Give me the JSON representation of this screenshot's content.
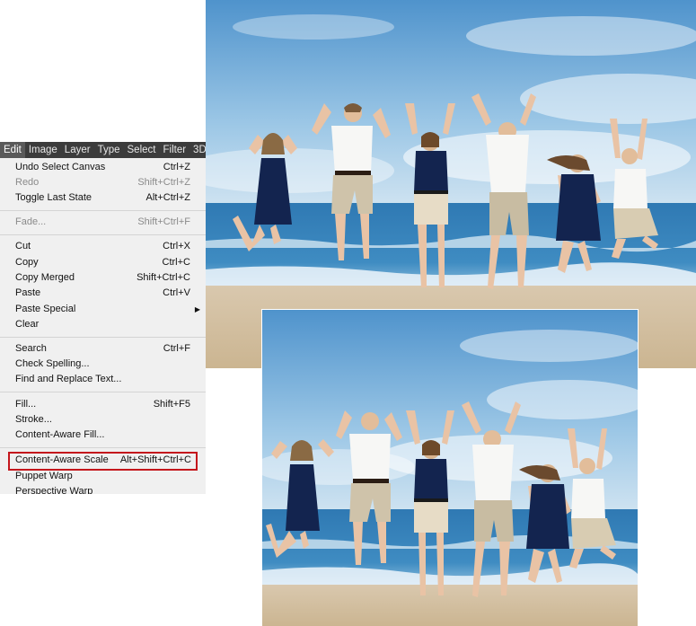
{
  "menubar": {
    "items": [
      "Edit",
      "Image",
      "Layer",
      "Type",
      "Select",
      "Filter",
      "3D"
    ],
    "active": "Edit"
  },
  "edit_menu": {
    "undo": {
      "label": "Undo Select Canvas",
      "shortcut": "Ctrl+Z"
    },
    "redo": {
      "label": "Redo",
      "shortcut": "Shift+Ctrl+Z"
    },
    "toggle_last_state": {
      "label": "Toggle Last State",
      "shortcut": "Alt+Ctrl+Z"
    },
    "fade": {
      "label": "Fade...",
      "shortcut": "Shift+Ctrl+F"
    },
    "cut": {
      "label": "Cut",
      "shortcut": "Ctrl+X"
    },
    "copy": {
      "label": "Copy",
      "shortcut": "Ctrl+C"
    },
    "copy_merged": {
      "label": "Copy Merged",
      "shortcut": "Shift+Ctrl+C"
    },
    "paste": {
      "label": "Paste",
      "shortcut": "Ctrl+V"
    },
    "paste_special": {
      "label": "Paste Special"
    },
    "clear": {
      "label": "Clear"
    },
    "search": {
      "label": "Search",
      "shortcut": "Ctrl+F"
    },
    "check_spelling": {
      "label": "Check Spelling..."
    },
    "find_replace": {
      "label": "Find and Replace Text..."
    },
    "fill": {
      "label": "Fill...",
      "shortcut": "Shift+F5"
    },
    "stroke": {
      "label": "Stroke..."
    },
    "content_aware_fill": {
      "label": "Content-Aware Fill..."
    },
    "content_aware_scale": {
      "label": "Content-Aware Scale",
      "shortcut": "Alt+Shift+Ctrl+C"
    },
    "puppet_warp": {
      "label": "Puppet Warp"
    },
    "perspective_warp": {
      "label": "Perspective Warp"
    }
  },
  "colors": {
    "highlight_border": "#c4161c",
    "menubar_bg": "#3c3c3c",
    "menu_bg": "#f0f0f0"
  },
  "photos": {
    "original": {
      "icon": "beach-family-jumping-photo"
    },
    "scaled": {
      "icon": "beach-family-jumping-photo-scaled"
    }
  }
}
